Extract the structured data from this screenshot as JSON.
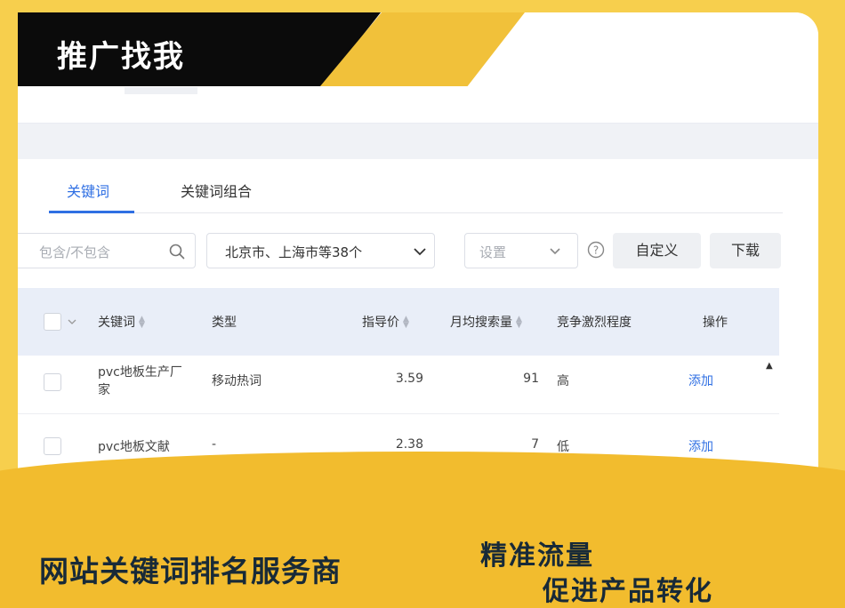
{
  "banner": {
    "title": "推广找我"
  },
  "tabs": [
    {
      "label": "关键词",
      "active": true
    },
    {
      "label": "关键词组合",
      "active": false
    }
  ],
  "filters": {
    "keyword_placeholder": "包含/不包含",
    "region": "北京市、上海市等38个",
    "settings_placeholder": "设置"
  },
  "buttons": {
    "customize": "自定义",
    "download": "下载"
  },
  "table": {
    "headers": [
      "关键词",
      "类型",
      "指导价",
      "月均搜索量",
      "竞争激烈程度",
      "操作"
    ],
    "rows": [
      {
        "keyword_l1": "pvc地板生产厂",
        "keyword_l2": "家",
        "type": "移动热词",
        "price": "3.59",
        "searches": "91",
        "competition": "高",
        "action": "添加"
      },
      {
        "keyword_l1": "pvc地板文献",
        "keyword_l2": "",
        "type": "-",
        "price": "2.38",
        "searches": "7",
        "competition": "低",
        "action": "添加"
      }
    ]
  },
  "footer": {
    "slogan_left": "网站关键词排名服务商",
    "slogan_right_1": "精准流量",
    "slogan_right_2": "促进产品转化"
  },
  "colors": {
    "accent_yellow": "#f2bc2e",
    "link_blue": "#2f6fe3",
    "banner_black": "#0b0b0b"
  },
  "icons": {
    "search": "search-icon",
    "dropdown": "chevron-down-icon",
    "help": "help-circle-icon",
    "sort": "sort-icon",
    "scroll": "scroll-up-icon"
  }
}
